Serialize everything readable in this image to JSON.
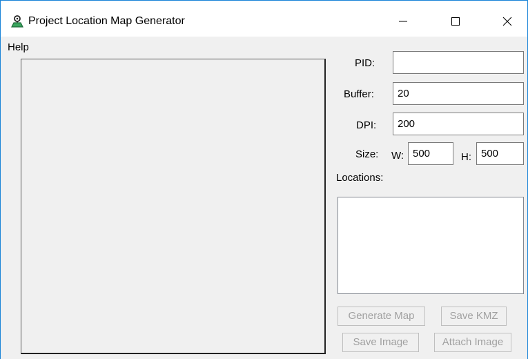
{
  "window": {
    "title": "Project Location Map Generator",
    "icon": "map-pin-person-icon",
    "controls": {
      "minimize": "minimize-icon",
      "maximize": "maximize-icon",
      "close": "close-icon"
    }
  },
  "menu": {
    "help": "Help"
  },
  "form": {
    "pid_label": "PID:",
    "pid_value": "",
    "buffer_label": "Buffer:",
    "buffer_value": "20",
    "dpi_label": "DPI:",
    "dpi_value": "200",
    "size_label": "Size:",
    "width_label": "W:",
    "width_value": "500",
    "height_label": "H:",
    "height_value": "500",
    "locations_label": "Locations:"
  },
  "buttons": {
    "generate_map": "Generate Map",
    "save_kmz": "Save KMZ",
    "save_image": "Save Image",
    "attach_image": "Attach Image"
  },
  "colors": {
    "accent_border": "#1883d7",
    "icon_green": "#2e8b57",
    "disabled_text": "#a0a0a0"
  }
}
